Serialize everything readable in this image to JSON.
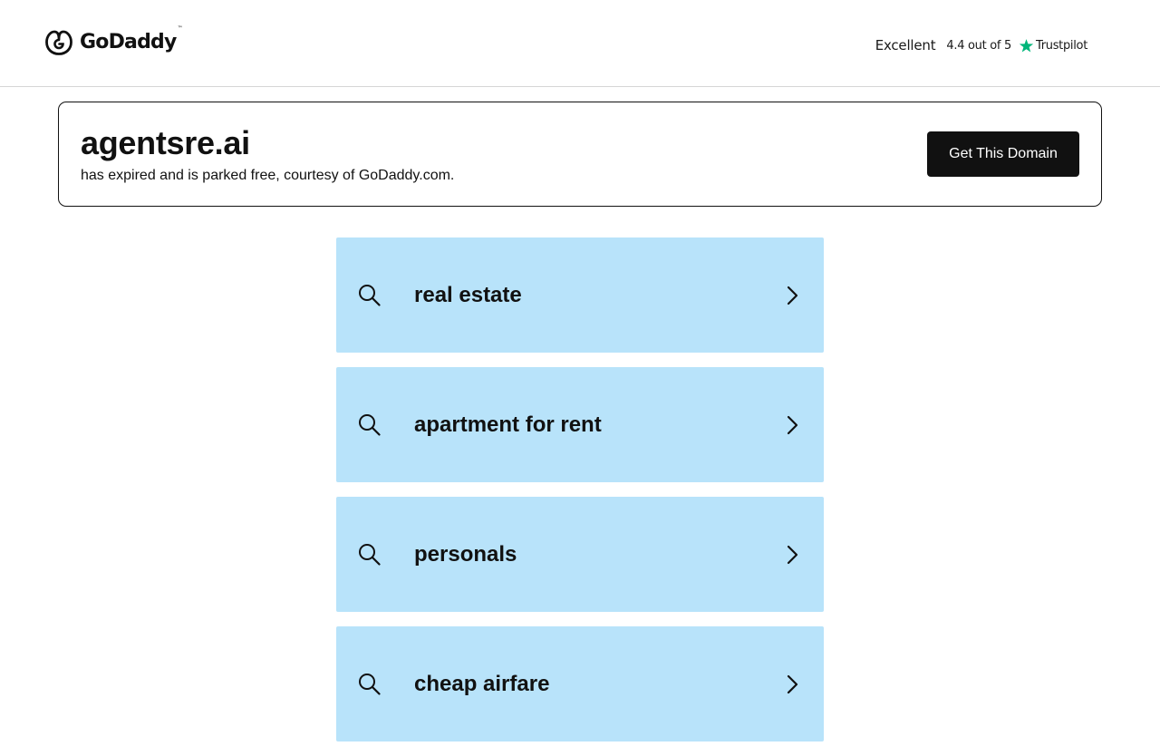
{
  "header": {
    "logo_text": "GoDaddy",
    "logo_tm": "™",
    "logo_icon": "godaddy-logo-icon",
    "trustpilot": {
      "rating_label": "Excellent",
      "score_text": "4.4 out of 5",
      "brand": "Trustpilot",
      "star_icon": "star-icon",
      "star_color": "#00b67a"
    }
  },
  "domain": {
    "name": "agentsre.ai",
    "status_text": "has expired and is parked free, courtesy of GoDaddy.com.",
    "cta_label": "Get This Domain"
  },
  "related_searches": {
    "background_color": "#b8e3fa",
    "items": [
      {
        "label": "real estate",
        "icon": "search-icon",
        "arrow": "chevron-right-icon"
      },
      {
        "label": "apartment for rent",
        "icon": "search-icon",
        "arrow": "chevron-right-icon"
      },
      {
        "label": "personals",
        "icon": "search-icon",
        "arrow": "chevron-right-icon"
      },
      {
        "label": "cheap airfare",
        "icon": "search-icon",
        "arrow": "chevron-right-icon"
      }
    ]
  }
}
